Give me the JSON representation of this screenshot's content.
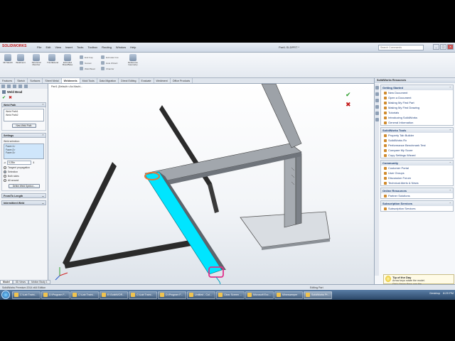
{
  "app": {
    "logo": "SOLIDWORKS",
    "doc_title": "Part1.SLDPRT *",
    "search_placeholder": "Search Commands"
  },
  "menus": [
    "File",
    "Edit",
    "View",
    "Insert",
    "Tools",
    "Toolbox",
    "Routing",
    "Window",
    "Help"
  ],
  "ribbon": {
    "buttons": [
      {
        "label": "3D Sketch",
        "icon": "3d-sketch-icon"
      },
      {
        "label": "Weldment",
        "icon": "weldment-icon"
      },
      {
        "label": "Structural Member",
        "icon": "structural-member-icon"
      },
      {
        "label": "Trim/Extend",
        "icon": "trim-extend-icon"
      },
      {
        "label": "Extruded Boss/Base",
        "icon": "extruded-boss-icon"
      },
      {
        "label": "Reference Geometry",
        "icon": "reference-geometry-icon"
      }
    ],
    "small": [
      "End Cap",
      "Gusset",
      "Weld Bead",
      "Extruded Cut",
      "Hole Wizard",
      "Chamfer"
    ]
  },
  "tabs": [
    "Features",
    "Sketch",
    "Surfaces",
    "Sheet Metal",
    "Weldments",
    "Mold Tools",
    "Data Migration",
    "Direct Editing",
    "Evaluate",
    "Weldment",
    "Office Products"
  ],
  "active_tab": "Weldments",
  "property_manager": {
    "title": "Weld Bead",
    "weld_path": {
      "header": "Weld Path",
      "items": [
        "Weld Path1",
        "Weld Path2"
      ],
      "button": "New Weld Path"
    },
    "settings": {
      "header": "Settings",
      "selection_label": "Weld selection:",
      "faces": [
        "Face<1>",
        "Face<2>",
        "Face<3>"
      ],
      "size": "0.25in",
      "options": [
        {
          "label": "Tangent propagation",
          "on": false
        },
        {
          "label": "Selection",
          "on": true
        },
        {
          "label": "Both sides",
          "on": false
        },
        {
          "label": "All around",
          "on": false
        }
      ],
      "button": "Define Weld Symbol..."
    },
    "from_to_length": "From/To Length",
    "intermittent": "Intermittent Weld"
  },
  "viewport": {
    "breadcrumb": "Part1 (Default<<As Machi...",
    "text_annotation": "0.25in"
  },
  "task_pane": {
    "title": "SolidWorks Resources",
    "sections": [
      {
        "head": "Getting Started",
        "items": [
          "New Document",
          "Open a Document",
          "Making My First Part",
          "Making My First Drawing",
          "Tutorials",
          "Introducing SolidWorks",
          "General Information"
        ]
      },
      {
        "head": "SolidWorks Tools",
        "items": [
          "Property Tab Builder",
          "SolidWorks Rx",
          "Performance Benchmark Test",
          "Compare My Score",
          "Copy Settings Wizard"
        ]
      },
      {
        "head": "Community",
        "items": [
          "Customer Portal",
          "User Groups",
          "Discussion Forum",
          "Technical Alerts & News"
        ]
      },
      {
        "head": "Online Resources",
        "items": [
          "Partner Solutions"
        ]
      },
      {
        "head": "Subscription Services",
        "items": [
          "Subscription Services"
        ]
      }
    ],
    "tip": {
      "title": "Tip of the Day",
      "body1": "Arrow keys rotate the model.",
      "body2": "Ctrl + Arrow Keys pan the"
    }
  },
  "status": {
    "left": "SolidWorks Premium 2014 x64 Edition",
    "right": "Editing Part"
  },
  "bottom_tabs": [
    "Model",
    "3D Views",
    "Motion Study 1"
  ],
  "taskbar": {
    "items": [
      "C:\\Lab Traini...",
      "D:\\Program F...",
      "C:\\Lab Traini...",
      "E:\\SolidWOR...",
      "C:\\Lab Traini...",
      "D:\\Program F...",
      "Untitled - Col...",
      "Clear Screen ...",
      "Microsoft Exc...",
      "Minesweeper",
      "SolidWorks Pr..."
    ],
    "active": 10,
    "desktop": "Desktop",
    "clock": "8:29 PM"
  },
  "colors": {
    "weld_highlight": "#00e5ff",
    "selection_edge": "#e0308a",
    "accent": "#1c62b8"
  }
}
